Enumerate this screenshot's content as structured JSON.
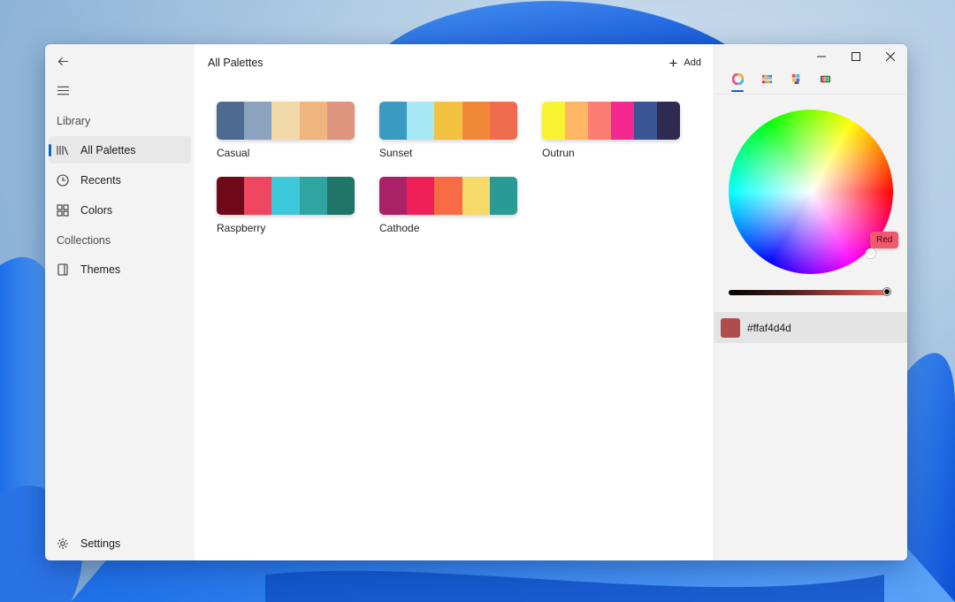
{
  "window": {
    "controls": {
      "minimize": "—",
      "maximize": "☐",
      "close": "✕"
    }
  },
  "sidebar": {
    "library_header": "Library",
    "collections_header": "Collections",
    "items": [
      {
        "label": "All Palettes",
        "icon": "library-icon",
        "selected": true
      },
      {
        "label": "Recents",
        "icon": "clock-icon"
      },
      {
        "label": "Colors",
        "icon": "grid-icon"
      }
    ],
    "collections": [
      {
        "label": "Themes",
        "icon": "document-icon"
      }
    ],
    "settings_label": "Settings"
  },
  "main": {
    "title": "All Palettes",
    "add_label": "Add",
    "palettes": [
      {
        "name": "Casual",
        "colors": [
          "#4e6a90",
          "#8ca3bd",
          "#f1d9aa",
          "#efb57f",
          "#dd957d"
        ]
      },
      {
        "name": "Sunset",
        "colors": [
          "#3b9ac0",
          "#a7e8f4",
          "#f0c23f",
          "#f18838",
          "#ef6c4e"
        ]
      },
      {
        "name": "Outrun",
        "colors": [
          "#f7f331",
          "#fdb663",
          "#fc7d73",
          "#f4288f",
          "#3c5594",
          "#2f2a51"
        ]
      },
      {
        "name": "Raspberry",
        "colors": [
          "#6e0a1a",
          "#ee4660",
          "#3ec8db",
          "#30a4a0",
          "#1e7568"
        ]
      },
      {
        "name": "Cathode",
        "colors": [
          "#a92267",
          "#ef2058",
          "#f76c45",
          "#f6da69",
          "#2a9a94"
        ]
      }
    ]
  },
  "picker": {
    "tabs": [
      "color-wheel-icon",
      "palette-strips-icon",
      "swatch-grid-icon",
      "swatch-row-icon"
    ],
    "tooltip": "Red",
    "hex_value": "#ffaf4d4d",
    "swatch_color": "#af4d4d"
  }
}
